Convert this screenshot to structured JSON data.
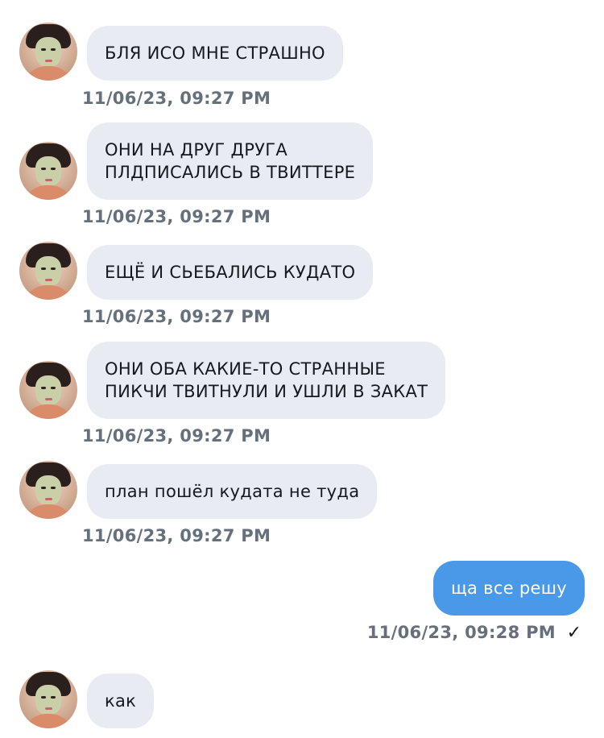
{
  "messages": [
    {
      "direction": "in",
      "text": "БЛЯ ИСО МНЕ СТРАШНО",
      "time": "11/06/23, 09:27 PM"
    },
    {
      "direction": "in",
      "text": "ОНИ НА ДРУГ ДРУГА\nПЛДПИСАЛИСЬ В ТВИТТЕРЕ",
      "time": "11/06/23, 09:27 PM"
    },
    {
      "direction": "in",
      "text": "ЕЩЁ И СЬЕБАЛИСЬ КУДАТО",
      "time": "11/06/23, 09:27 PM"
    },
    {
      "direction": "in",
      "text": "ОНИ ОБА КАКИЕ-ТО СТРАННЫЕ\nПИКЧИ ТВИТНУЛИ И УШЛИ В ЗАКАТ",
      "time": "11/06/23, 09:27 PM"
    },
    {
      "direction": "in",
      "text": "план пошёл кудата не туда",
      "time": "11/06/23, 09:27 PM"
    },
    {
      "direction": "out",
      "text": "ща все решу",
      "time": "11/06/23, 09:28 PM",
      "status": "✓"
    },
    {
      "direction": "in",
      "text": "как"
    }
  ],
  "colors": {
    "incoming_bubble": "#e9ebf2",
    "outgoing_bubble": "#4a99e9",
    "timestamp": "#66707c"
  }
}
